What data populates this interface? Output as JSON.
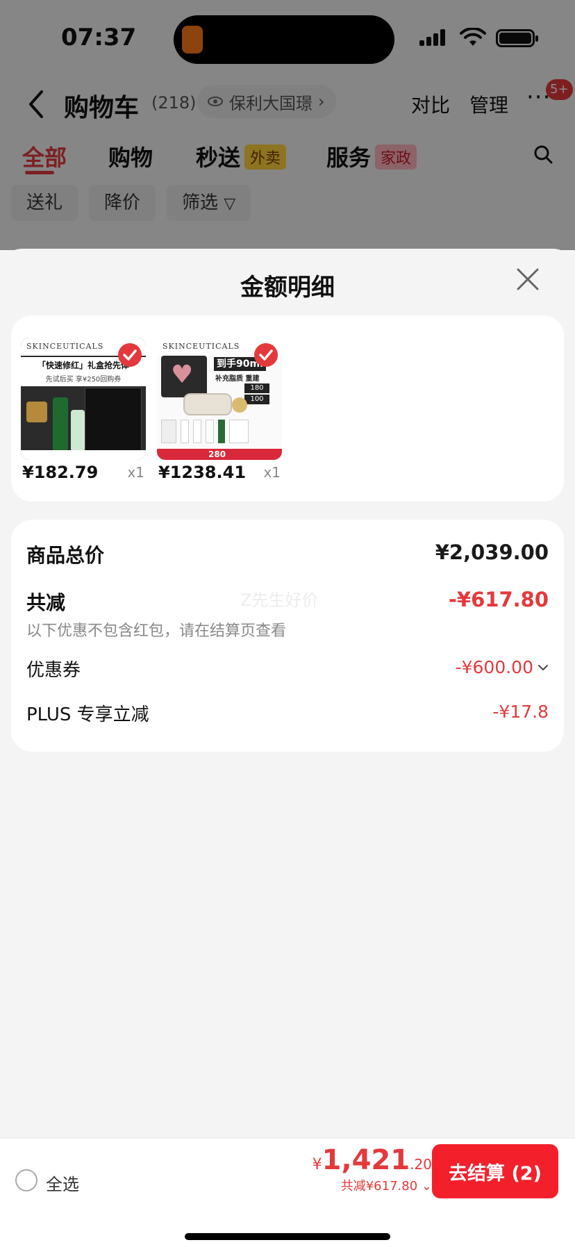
{
  "status_bar": {
    "time": "07:37"
  },
  "header": {
    "title": "购物车",
    "count": "(218)",
    "location": "保利大国璟",
    "compare": "对比",
    "manage": "管理",
    "more_badge": "5+"
  },
  "tabs": [
    {
      "label": "全部",
      "tag": ""
    },
    {
      "label": "购物",
      "tag": ""
    },
    {
      "label": "秒送",
      "tag": "外卖"
    },
    {
      "label": "服务",
      "tag": "家政"
    }
  ],
  "filters": [
    "送礼",
    "降价",
    "筛选"
  ],
  "sheet": {
    "title": "金额明细",
    "products": [
      {
        "brand": "SKINCEUTICALS",
        "price": "¥182.79",
        "qty": "x1",
        "promo_text": "「快速修红」礼盒抢先体",
        "sub_text": "先试后买 享¥250回购券",
        "selected": true
      },
      {
        "brand": "SKINCEUTICALS",
        "price": "¥1238.41",
        "qty": "x1",
        "promo_text": "到手90ml",
        "sub_text": "补充脂质 重建",
        "badge_180": "180",
        "badge_100": "100",
        "banner": "280",
        "selected": true
      }
    ],
    "summary": {
      "total_label": "商品总价",
      "total_value": "¥2,039.00",
      "discount_label": "共减",
      "discount_value": "-¥617.80",
      "discount_note": "以下优惠不包含红包，请在结算页查看",
      "watermark": "Z先生好价",
      "coupon_label": "优惠券",
      "coupon_value": "-¥600.00",
      "plus_label": "PLUS 专享立减",
      "plus_value": "-¥17.8"
    }
  },
  "bottom_bar": {
    "select_all": "全选",
    "yen": "¥",
    "total_int": "1,421",
    "total_dec": ".20",
    "saved": "共减¥617.80",
    "checkout": "去结算 (2)"
  },
  "colors": {
    "accent": "#e4393c",
    "checkout_bg": "#f3202c",
    "page_bg": "#f4f4f4"
  }
}
